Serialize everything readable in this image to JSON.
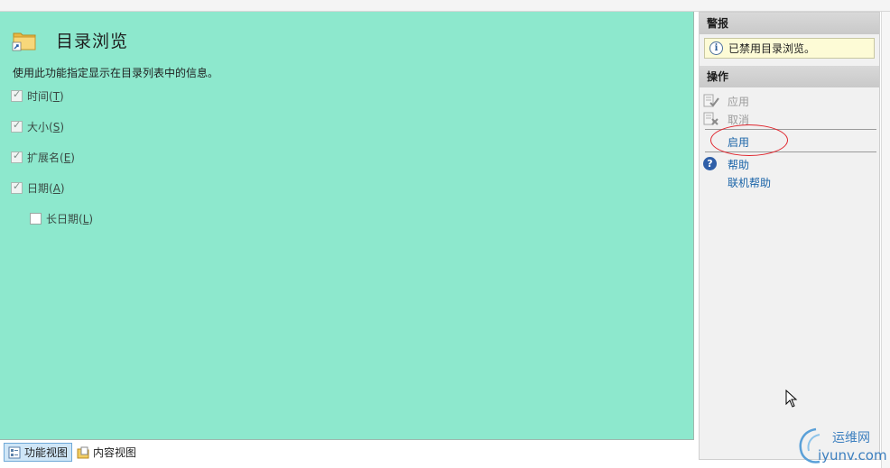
{
  "feature": {
    "title": "目录浏览",
    "description": "使用此功能指定显示在目录列表中的信息。",
    "options": [
      {
        "label": "时间(",
        "key": "T",
        "suffix": ")",
        "checked": true
      },
      {
        "label": "大小(",
        "key": "S",
        "suffix": ")",
        "checked": true
      },
      {
        "label": "扩展名(",
        "key": "E",
        "suffix": ")",
        "checked": true
      },
      {
        "label": "日期(",
        "key": "A",
        "suffix": ")",
        "checked": true
      },
      {
        "label": "长日期(",
        "key": "L",
        "suffix": ")",
        "checked": false
      }
    ]
  },
  "view_tabs": {
    "features_view": "功能视图",
    "content_view": "内容视图"
  },
  "actions_pane": {
    "alerts_heading": "警报",
    "alert_message": "已禁用目录浏览。",
    "actions_heading": "操作",
    "apply": "应用",
    "cancel": "取消",
    "enable": "启用",
    "help": "帮助",
    "online_help": "联机帮助"
  },
  "watermark": {
    "text_cn": "运维网",
    "text_url": "iyunv.com"
  },
  "colors": {
    "main_background": "#8de8cd",
    "link": "#1a64a8",
    "highlight_ellipse": "#e0252d"
  }
}
